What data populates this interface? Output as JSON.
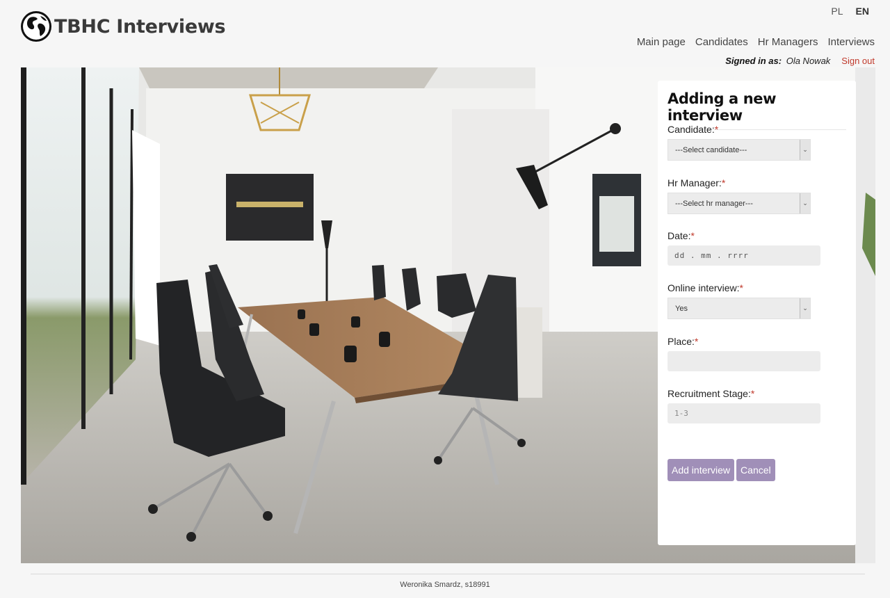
{
  "app": {
    "title": "TBHC Interviews"
  },
  "lang": {
    "pl": "PL",
    "en": "EN"
  },
  "nav": [
    {
      "label": "Main page"
    },
    {
      "label": "Candidates"
    },
    {
      "label": "Hr Managers"
    },
    {
      "label": "Interviews"
    }
  ],
  "session": {
    "signed_in_label": "Signed in as:",
    "user": "Ola Nowak",
    "sign_out": "Sign out"
  },
  "form": {
    "title": "Adding a new interview",
    "candidate": {
      "label": "Candidate:",
      "value": "---Select candidate---"
    },
    "hr_manager": {
      "label": "Hr Manager:",
      "value": "---Select hr manager---"
    },
    "date": {
      "label": "Date:",
      "placeholder": "dd . mm . rrrr"
    },
    "online": {
      "label": "Online interview:",
      "value": "Yes"
    },
    "place": {
      "label": "Place:",
      "value": ""
    },
    "stage": {
      "label": "Recruitment Stage:",
      "placeholder": "1-3"
    },
    "required_mark": "*",
    "submit": "Add interview",
    "cancel": "Cancel"
  },
  "footer": {
    "text": "Weronika Smardz, s18991"
  },
  "colors": {
    "accent": "#a08fb8",
    "danger": "#c0392b"
  }
}
